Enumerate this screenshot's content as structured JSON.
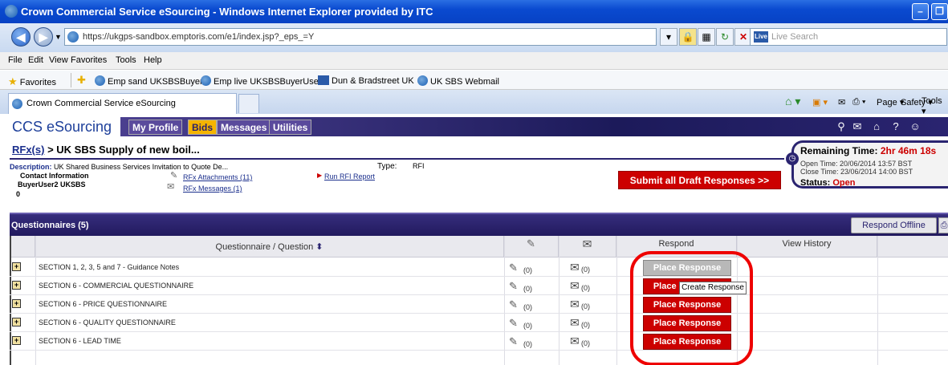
{
  "window": {
    "title": "Crown Commercial Service eSourcing - Windows Internet Explorer provided by ITC"
  },
  "address_bar": {
    "url": "https://ukgps-sandbox.emptoris.com/e1/index.jsp?_eps_=Y",
    "search_placeholder": "Live Search"
  },
  "menu": [
    "File",
    "Edit",
    "View",
    "Favorites",
    "Tools",
    "Help"
  ],
  "favorites_bar": {
    "label": "Favorites",
    "items": [
      "Emp sand UKSBSBuyer2",
      "Emp live UKSBSBuyerUser1",
      "Dun & Bradstreet UK",
      "UK SBS Webmail"
    ]
  },
  "browser_tab": {
    "label": "Crown Commercial Service eSourcing"
  },
  "command_bar": [
    "Page ▾",
    "Safety ▾",
    "Tools ▾"
  ],
  "app": {
    "logo": "CCS eSourcing",
    "nav": [
      "My Profile",
      "Bids",
      "Messages",
      "Utilities"
    ],
    "active_nav": "Bids"
  },
  "breadcrumb": {
    "link": "RFx(s)",
    "separator": " > ",
    "current": "UK SBS Supply of new boil..."
  },
  "timer": {
    "remaining_label": "Remaining Time:",
    "remaining_value": "2hr 46m 18s",
    "open_time": "Open Time: 20/06/2014 13:57 BST",
    "close_time": "Close Time: 23/06/2014 14:00 BST",
    "status_label": "Status:",
    "status_value": "Open"
  },
  "description": {
    "label": "Description:",
    "text": "UK Shared Business Services Invitation to Quote De...",
    "type_label": "Type:",
    "type_value": "RFI",
    "contact_label": "Contact Information",
    "contact_name": "BuyerUser2 UKSBS",
    "contact_extra": "0",
    "attachments_link": "RFx Attachments (11)",
    "messages_link": "RFx Messages (1)",
    "report_link": "Run RFI Report",
    "submit_button": "Submit all Draft Responses >>"
  },
  "questionnaires": {
    "title": "Questionnaires (5)",
    "respond_offline": "Respond Offline",
    "columns": {
      "question": "Questionnaire / Question",
      "respond": "Respond",
      "history": "View History"
    },
    "rows": [
      {
        "name": "SECTION 1, 2, 3, 5 and 7 - Guidance Notes",
        "attachments": "(0)",
        "messages": "(0)",
        "button": "Place Response",
        "disabled": true
      },
      {
        "name": "SECTION 6 - COMMERCIAL QUESTIONNAIRE",
        "attachments": "(0)",
        "messages": "(0)",
        "button": "Place Response",
        "disabled": false
      },
      {
        "name": "SECTION 6 - PRICE QUESTIONNAIRE",
        "attachments": "(0)",
        "messages": "(0)",
        "button": "Place Response",
        "disabled": false
      },
      {
        "name": "SECTION 6 - QUALITY QUESTIONNAIRE",
        "attachments": "(0)",
        "messages": "(0)",
        "button": "Place Response",
        "disabled": false
      },
      {
        "name": "SECTION 6 - LEAD TIME",
        "attachments": "(0)",
        "messages": "(0)",
        "button": "Place Response",
        "disabled": false
      }
    ],
    "tooltip": "Create Response"
  },
  "colors": {
    "title_bar": "#0a4ad0",
    "app_band": "#2a2470",
    "active_tab": "#f5b400",
    "action_red": "#cc0000",
    "annotation_red": "#ee0000"
  }
}
